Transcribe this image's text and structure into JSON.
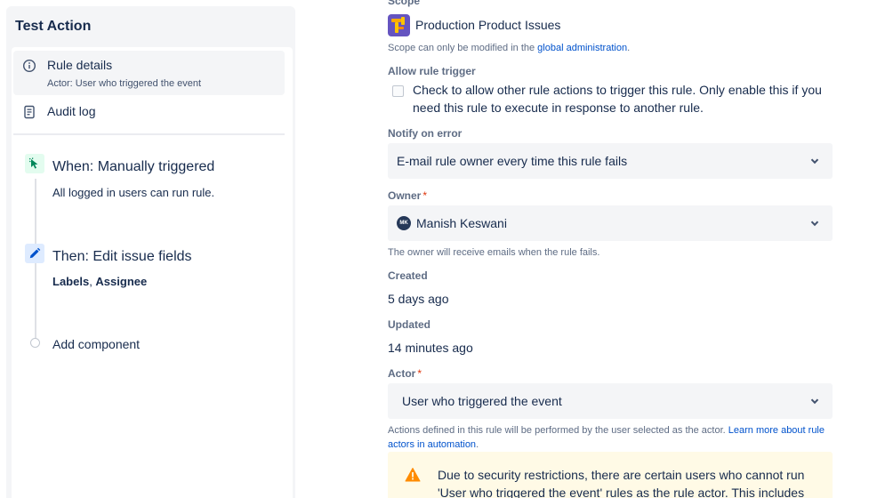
{
  "sidebar": {
    "title": "Test Action",
    "rule_details": {
      "label": "Rule details",
      "sub": "Actor: User who triggered the event"
    },
    "audit_log": {
      "label": "Audit log"
    },
    "trigger": {
      "title": "When: Manually triggered",
      "desc": "All logged in users can run rule."
    },
    "action": {
      "title": "Then: Edit issue fields",
      "fields_bold_1": "Labels",
      "sep": ", ",
      "fields_bold_2": "Assignee"
    },
    "add_component": "Add component"
  },
  "details": {
    "scope": {
      "label": "Scope",
      "name": "Production Product Issues",
      "help_prefix": "Scope can only be modified in the ",
      "help_link": "global administration",
      "help_suffix": "."
    },
    "allow_trigger": {
      "label": "Allow rule trigger",
      "checkbox_text": "Check to allow other rule actions to trigger this rule. Only enable this if you need this rule to execute in response to another rule.",
      "checked": false
    },
    "notify": {
      "label": "Notify on error",
      "value": "E-mail rule owner every time this rule fails"
    },
    "owner": {
      "label": "Owner",
      "required": "*",
      "avatar_initials": "MK",
      "value": "Manish Keswani",
      "help": "The owner will receive emails when the rule fails."
    },
    "created": {
      "label": "Created",
      "value": "5 days ago"
    },
    "updated": {
      "label": "Updated",
      "value": "14 minutes ago"
    },
    "actor": {
      "label": "Actor",
      "required": "*",
      "value": "User who triggered the event",
      "help_prefix": "Actions defined in this rule will be performed by the user selected as the actor. ",
      "help_link": "Learn more about rule actors in automation",
      "help_suffix": "."
    },
    "warning": {
      "text": "Due to security restrictions, there are certain users who cannot run 'User who triggered the event' rules as the rule actor. This includes"
    }
  },
  "colors": {
    "accent": "#0052cc",
    "required": "#de350b",
    "warning_bg": "#fffae6",
    "warning_icon": "#ff8b00",
    "trigger_icon": "#00875a",
    "action_icon": "#0052cc"
  }
}
